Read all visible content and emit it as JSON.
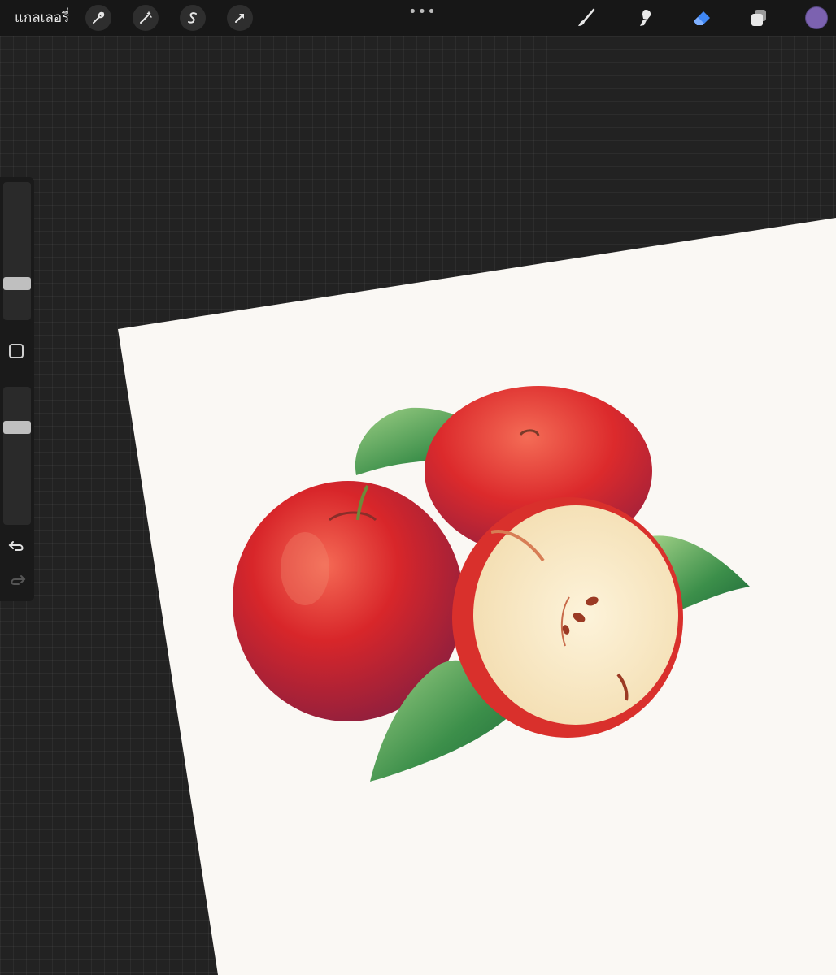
{
  "topbar": {
    "gallery_label": "แกลเลอรี่",
    "more_label": "•••",
    "current_color": "#7c62b0",
    "accent_color": "#3f87f5"
  },
  "left_tools": [
    "wrench-icon",
    "magic-wand-icon",
    "selection-icon",
    "transform-arrow-icon"
  ],
  "right_tools": [
    "brush-icon",
    "smudge-icon",
    "eraser-icon",
    "layers-icon"
  ],
  "sidebar": {
    "brush_size_level": 0.18,
    "opacity_level": 0.55
  },
  "canvas": {
    "paper_color": "#faf8f4",
    "artwork": "apples-illustration"
  }
}
